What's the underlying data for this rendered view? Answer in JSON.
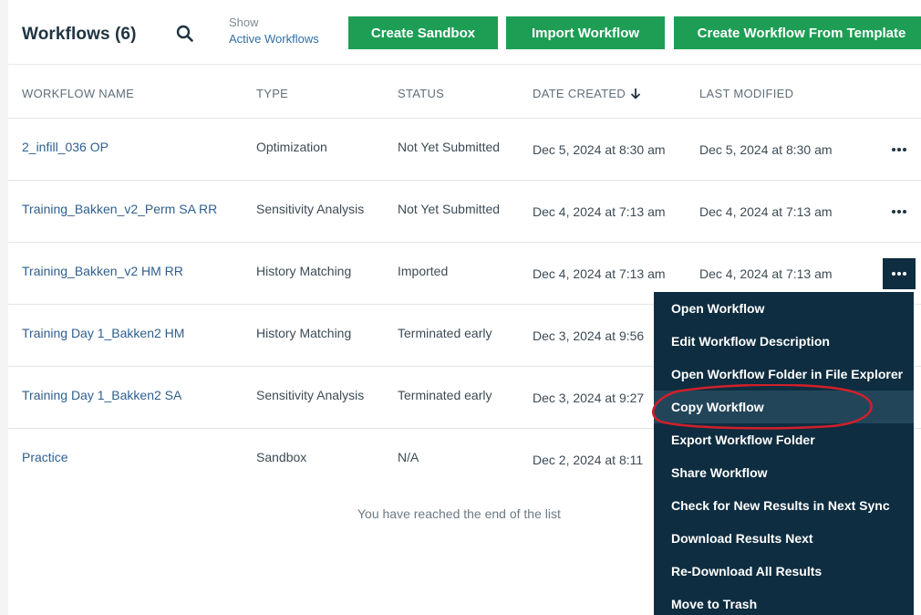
{
  "header": {
    "title": "Workflows (6)",
    "search_icon": "search-icon",
    "show_label": "Show",
    "show_link": "Active Workflows",
    "buttons": {
      "create_sandbox": "Create Sandbox",
      "import_workflow": "Import Workflow",
      "create_from_template": "Create Workflow From Template"
    },
    "accent_color": "#1e9e55"
  },
  "table": {
    "columns": [
      "WORKFLOW NAME",
      "TYPE",
      "STATUS",
      "DATE CREATED",
      "LAST MODIFIED"
    ],
    "sort_icon": "arrow-down-icon",
    "rows": [
      {
        "name": "2_infill_036 OP",
        "type": "Optimization",
        "status": "Not Yet Submitted",
        "created": "Dec 5, 2024 at 8:30 am",
        "modified": "Dec 5, 2024 at 8:30 am"
      },
      {
        "name": "Training_Bakken_v2_Perm SA RR",
        "type": "Sensitivity Analysis",
        "status": "Not Yet Submitted",
        "created": "Dec 4, 2024 at 7:13 am",
        "modified": "Dec 4, 2024 at 7:13 am"
      },
      {
        "name": "Training_Bakken_v2 HM RR",
        "type": "History Matching",
        "status": "Imported",
        "created": "Dec 4, 2024 at 7:13 am",
        "modified": "Dec 4, 2024 at 7:13 am"
      },
      {
        "name": "Training Day 1_Bakken2 HM",
        "type": "History Matching",
        "status": "Terminated early",
        "created": "Dec 3, 2024 at 9:56",
        "modified": ""
      },
      {
        "name": "Training Day 1_Bakken2 SA",
        "type": "Sensitivity Analysis",
        "status": "Terminated early",
        "created": "Dec 3, 2024 at 9:27",
        "modified": ""
      },
      {
        "name": "Practice",
        "type": "Sandbox",
        "status": "N/A",
        "created": "Dec 2, 2024 at 8:11",
        "modified": ""
      }
    ],
    "end_message": "You have reached the end of the list"
  },
  "context_menu": {
    "items": [
      "Open Workflow",
      "Edit Workflow Description",
      "Open Workflow Folder in File Explorer",
      "Copy Workflow",
      "Export Workflow Folder",
      "Share Workflow",
      "Check for New Results in Next Sync",
      "Download Results Next",
      "Re-Download All Results",
      "Move to Trash"
    ],
    "background_color": "#0e2d40",
    "highlight_color": "#d0202a"
  }
}
